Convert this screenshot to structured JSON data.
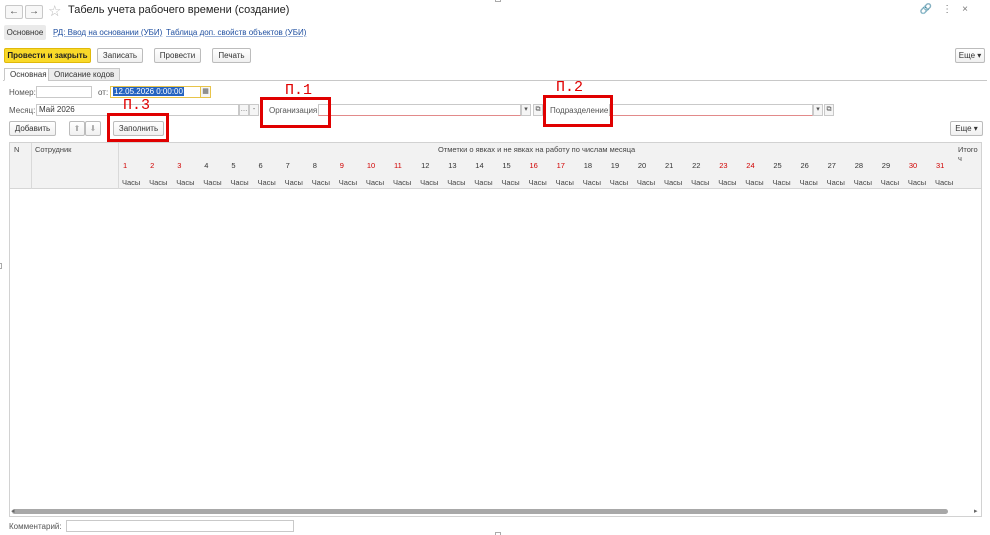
{
  "window": {
    "title": "Табель учета рабочего времени (создание)",
    "back_glyph": "←",
    "forward_glyph": "→",
    "icons": [
      "link-icon",
      "more-vertical-icon",
      "close-icon"
    ]
  },
  "links": {
    "active": "Основное",
    "items": [
      "РД: Ввод на основании (УБИ)",
      "Таблица доп. свойств объектов (УБИ)"
    ]
  },
  "toolbar": {
    "post_and_close": "Провести и закрыть",
    "save": "Записать",
    "post": "Провести",
    "print": "Печать",
    "more": "Еще"
  },
  "tabs": [
    "Основная",
    "Описание кодов"
  ],
  "form": {
    "number_label": "Номер:",
    "number_value": "",
    "date_label": "от:",
    "date_value": "12.05.2026  0:00:00",
    "month_label": "Месяц:",
    "month_value": "Май 2026",
    "org_label": "Организация:",
    "org_value": "",
    "dept_label": "Подразделение:",
    "dept_value": ""
  },
  "table_toolbar": {
    "add": "Добавить",
    "fill": "Заполнить",
    "more": "Еще"
  },
  "annotations": [
    "П.1",
    "П.2",
    "П.3"
  ],
  "table": {
    "col_n": "N",
    "col_employee": "Сотрудник",
    "group_header": "Отметки о явках и не явках на работу по числам месяца",
    "col_total": "Итого ч",
    "hours_label": "Часы",
    "days": [
      "1",
      "2",
      "3",
      "4",
      "5",
      "6",
      "7",
      "8",
      "9",
      "10",
      "11",
      "12",
      "13",
      "14",
      "15",
      "16",
      "17",
      "18",
      "19",
      "20",
      "21",
      "22",
      "23",
      "24",
      "25",
      "26",
      "27",
      "28",
      "29",
      "30",
      "31"
    ],
    "weekend_days": [
      "1",
      "2",
      "3",
      "9",
      "10",
      "11",
      "16",
      "17",
      "23",
      "24",
      "30",
      "31"
    ],
    "weekend_color": "#d00000"
  },
  "footer": {
    "comment_label": "Комментарий:",
    "comment_value": ""
  }
}
